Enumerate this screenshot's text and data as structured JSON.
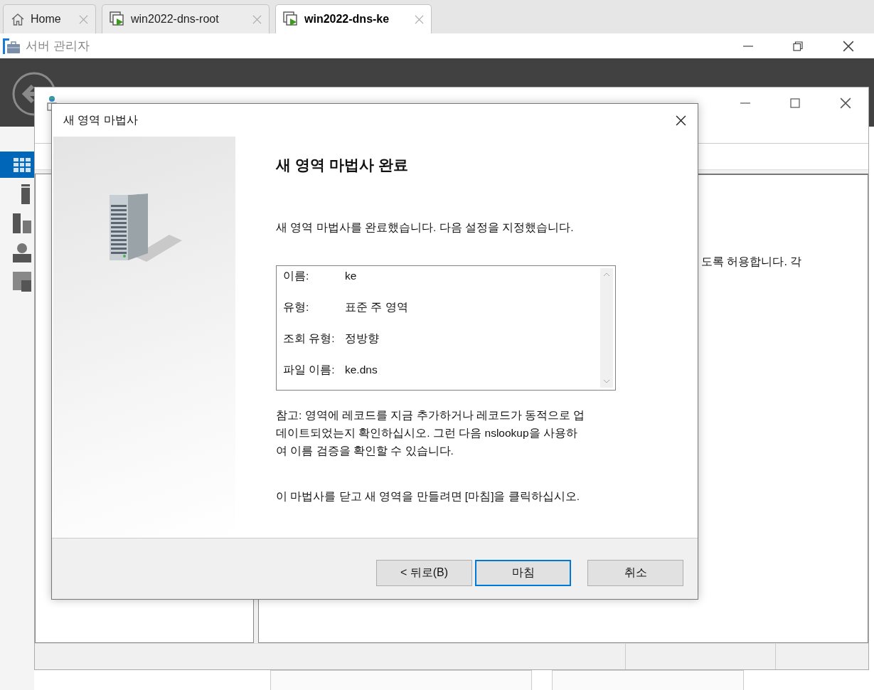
{
  "vm_tabs": [
    {
      "label": "Home",
      "kind": "home",
      "selected": false
    },
    {
      "label": "win2022-dns-root",
      "kind": "vm",
      "selected": false
    },
    {
      "label": "win2022-dns-ke",
      "kind": "vm",
      "selected": true
    }
  ],
  "server_manager": {
    "title": "서버 관리자"
  },
  "dns_manager": {
    "right_pane_text": "도록 허용합니다. 각"
  },
  "wizard": {
    "title": "새 영역 마법사",
    "heading": "새 영역 마법사 완료",
    "intro": "새 영역 마법사를 완료했습니다. 다음 설정을 지정했습니다.",
    "settings": [
      {
        "label": "이름:",
        "value": "ke"
      },
      {
        "label": "유형:",
        "value": "표준 주 영역"
      },
      {
        "label": "조회 유형:",
        "value": "정방향"
      },
      {
        "label": "파일 이름:",
        "value": "ke.dns"
      }
    ],
    "note_lines": [
      "참고: 영역에 레코드를 지금 추가하거나 레코드가 동적으로 업",
      "데이트되었는지 확인하십시오. 그런 다음 nslookup을 사용하",
      "여 이름 검증을 확인할 수 있습니다."
    ],
    "finish_hint": "이 마법사를 닫고 새 영역을 만들려면 [마침]을 클릭하십시오.",
    "buttons": [
      {
        "label": "< 뒤로(B)",
        "default": false
      },
      {
        "label": "마침",
        "default": true
      },
      {
        "label": "취소",
        "default": false
      }
    ]
  }
}
